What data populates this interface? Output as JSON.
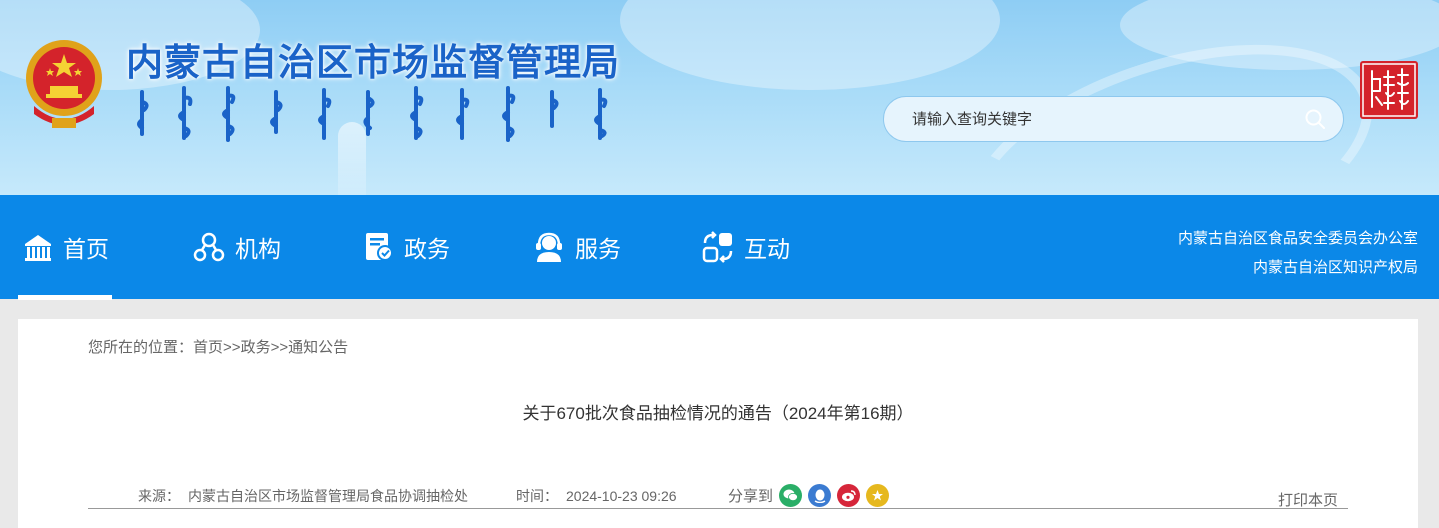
{
  "header": {
    "site_title": "内蒙古自治区市场监督管理局",
    "mongolian_subtitle": "ᠥᠪᠦᠷ ᠮᠣᠩᠭᠣᠯ ᠤᠨ ᠵᠠᠬᠠ ᠵᠡᠭᠡᠯᠢ ᠶᠢᠨ ᠬᠢᠨᠠᠨ ᠬᠠᠮᠠᠭᠠᠯᠠᠬᠤ ᠬᠣᠷᠢᠶ᠎ᠠ",
    "search_placeholder": "请输入查询关键字",
    "seal_text": "内蒙古"
  },
  "nav": {
    "items": [
      {
        "label": "首页",
        "icon": "home-building-icon",
        "active": true
      },
      {
        "label": "机构",
        "icon": "organization-icon",
        "active": false
      },
      {
        "label": "政务",
        "icon": "government-doc-icon",
        "active": false
      },
      {
        "label": "服务",
        "icon": "service-headset-icon",
        "active": false
      },
      {
        "label": "互动",
        "icon": "interaction-icon",
        "active": false
      }
    ],
    "right_links": [
      "内蒙古自治区食品安全委员会办公室",
      "内蒙古自治区知识产权局"
    ]
  },
  "breadcrumb": {
    "prefix": "您所在的位置：",
    "items": [
      "首页",
      "政务",
      "通知公告"
    ],
    "separator": ">>"
  },
  "article": {
    "title": "关于670批次食品抽检情况的通告（2024年第16期）",
    "source_label": "来源：",
    "source_value": "内蒙古自治区市场监督管理局食品协调抽检处",
    "time_label": "时间：",
    "time_value": "2024-10-23 09:26",
    "share_label": "分享到",
    "share_icons": [
      "wechat-icon",
      "qq-icon",
      "weibo-icon",
      "qzone-icon"
    ],
    "print_label": "打印本页"
  },
  "colors": {
    "nav_bg": "#0b88e8",
    "title_blue": "#1a63c8",
    "wechat": "#2aae67",
    "qq": "#3b7bd1",
    "weibo": "#d6263a",
    "qzone": "#e6b81e"
  }
}
